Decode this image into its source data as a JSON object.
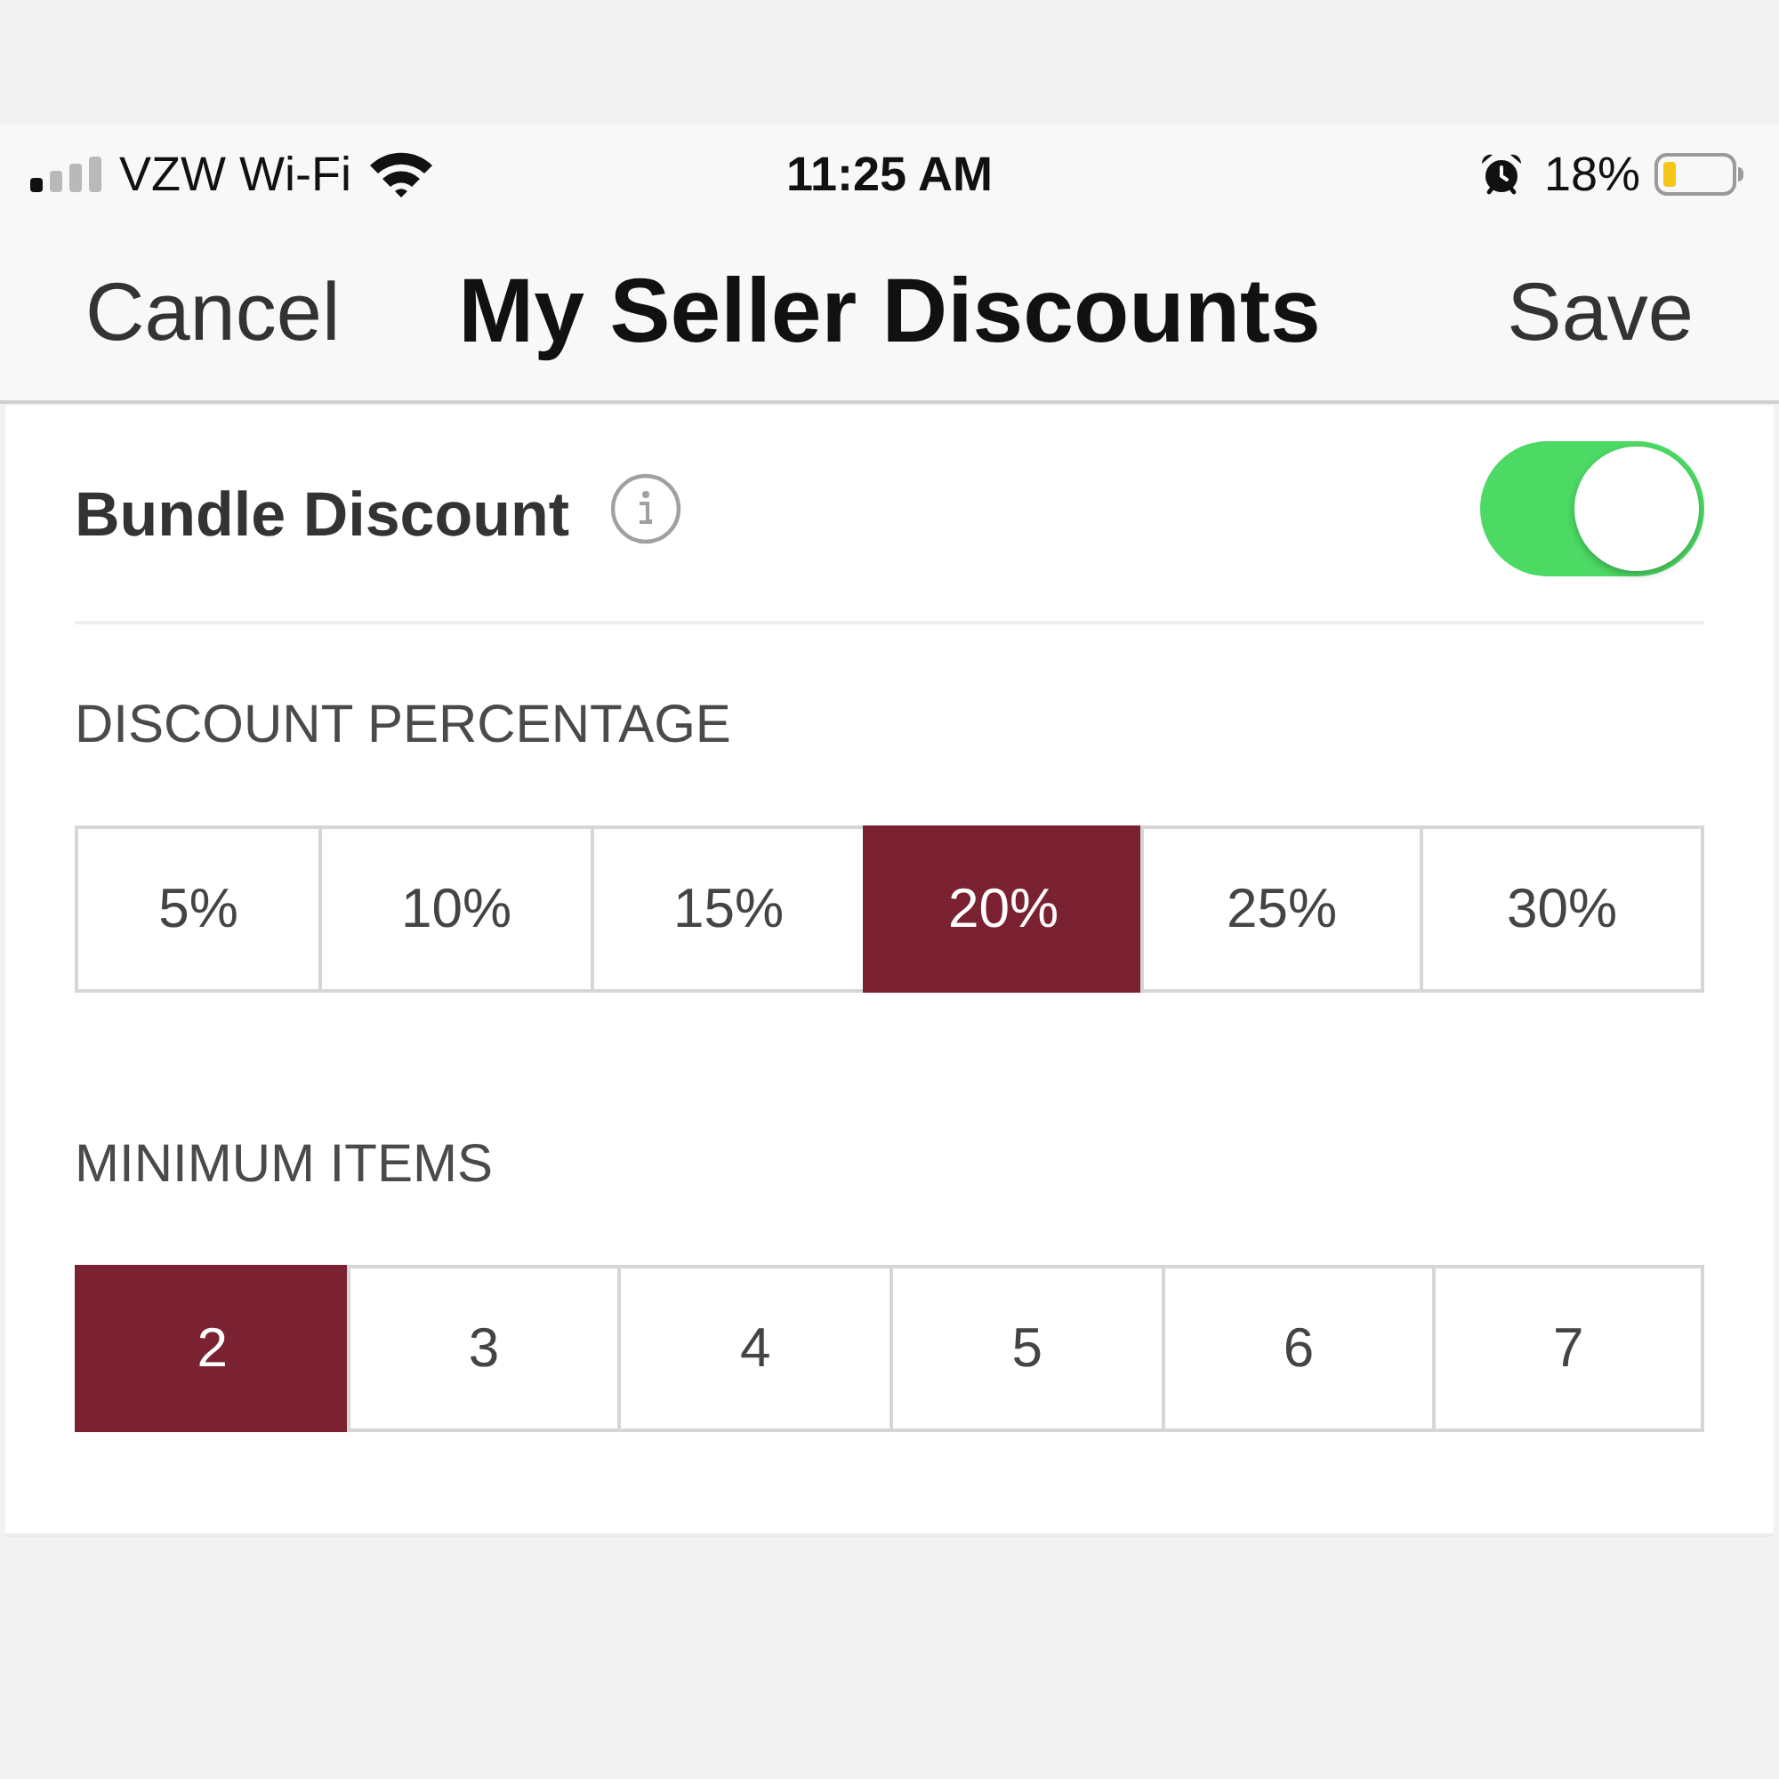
{
  "status_bar": {
    "carrier": "VZW Wi-Fi",
    "time": "11:25 AM",
    "battery": "18%"
  },
  "nav_bar": {
    "cancel": "Cancel",
    "title": "My Seller Discounts",
    "save": "Save"
  },
  "bundle_discount": {
    "label": "Bundle Discount",
    "on": true
  },
  "sections": [
    {
      "heading": "DISCOUNT PERCENTAGE",
      "options": [
        {
          "label": "5%",
          "selected": false
        },
        {
          "label": "10%",
          "selected": false
        },
        {
          "label": "15%",
          "selected": false
        },
        {
          "label": "20%",
          "selected": true
        },
        {
          "label": "25%",
          "selected": false
        },
        {
          "label": "30%",
          "selected": false
        }
      ]
    },
    {
      "heading": "MINIMUM ITEMS",
      "options": [
        {
          "label": "2",
          "selected": true
        },
        {
          "label": "3",
          "selected": false
        },
        {
          "label": "4",
          "selected": false
        },
        {
          "label": "5",
          "selected": false
        },
        {
          "label": "6",
          "selected": false
        },
        {
          "label": "7",
          "selected": false
        }
      ]
    }
  ]
}
